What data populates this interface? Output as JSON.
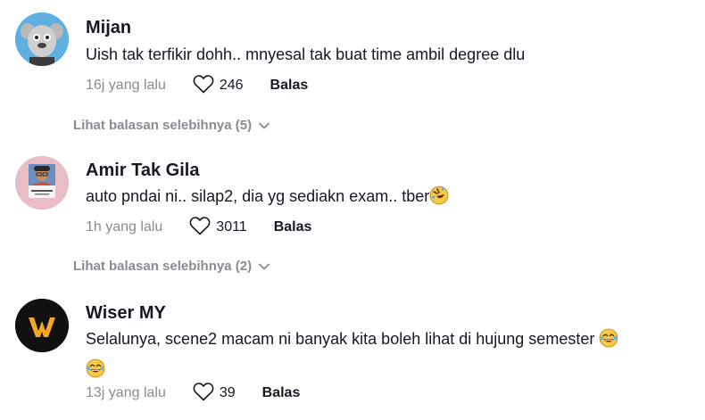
{
  "comments": [
    {
      "author": "Mijan",
      "text": "Uish tak terfikir dohh.. mnyesal tak buat time ambil degree dlu",
      "time": "16j yang lalu",
      "likes": "246",
      "reply_label": "Balas",
      "more_replies": "Lihat balasan selebihnya (5)"
    },
    {
      "author": "Amir Tak Gila",
      "text": "auto pndai ni.. silap2, dia yg sediakn exam.. tber",
      "time": "1h yang lalu",
      "likes": "3011",
      "reply_label": "Balas",
      "more_replies": "Lihat balasan selebihnya (2)"
    },
    {
      "author": "Wiser MY",
      "text_line1": "Selalunya, scene2 macam ni banyak kita boleh lihat di hujung semester",
      "time": "13j yang lalu",
      "likes": "39",
      "reply_label": "Balas"
    }
  ],
  "icons": {
    "like": "heart-outline-icon",
    "expand": "chevron-down-icon",
    "emoji_rofl": "rolling-on-floor-laughing-emoji",
    "emoji_joy": "grinning-sweat-emoji"
  },
  "colors": {
    "text": "#161823",
    "muted": "#8a8b91",
    "wiser_brand": "#f5a623"
  }
}
